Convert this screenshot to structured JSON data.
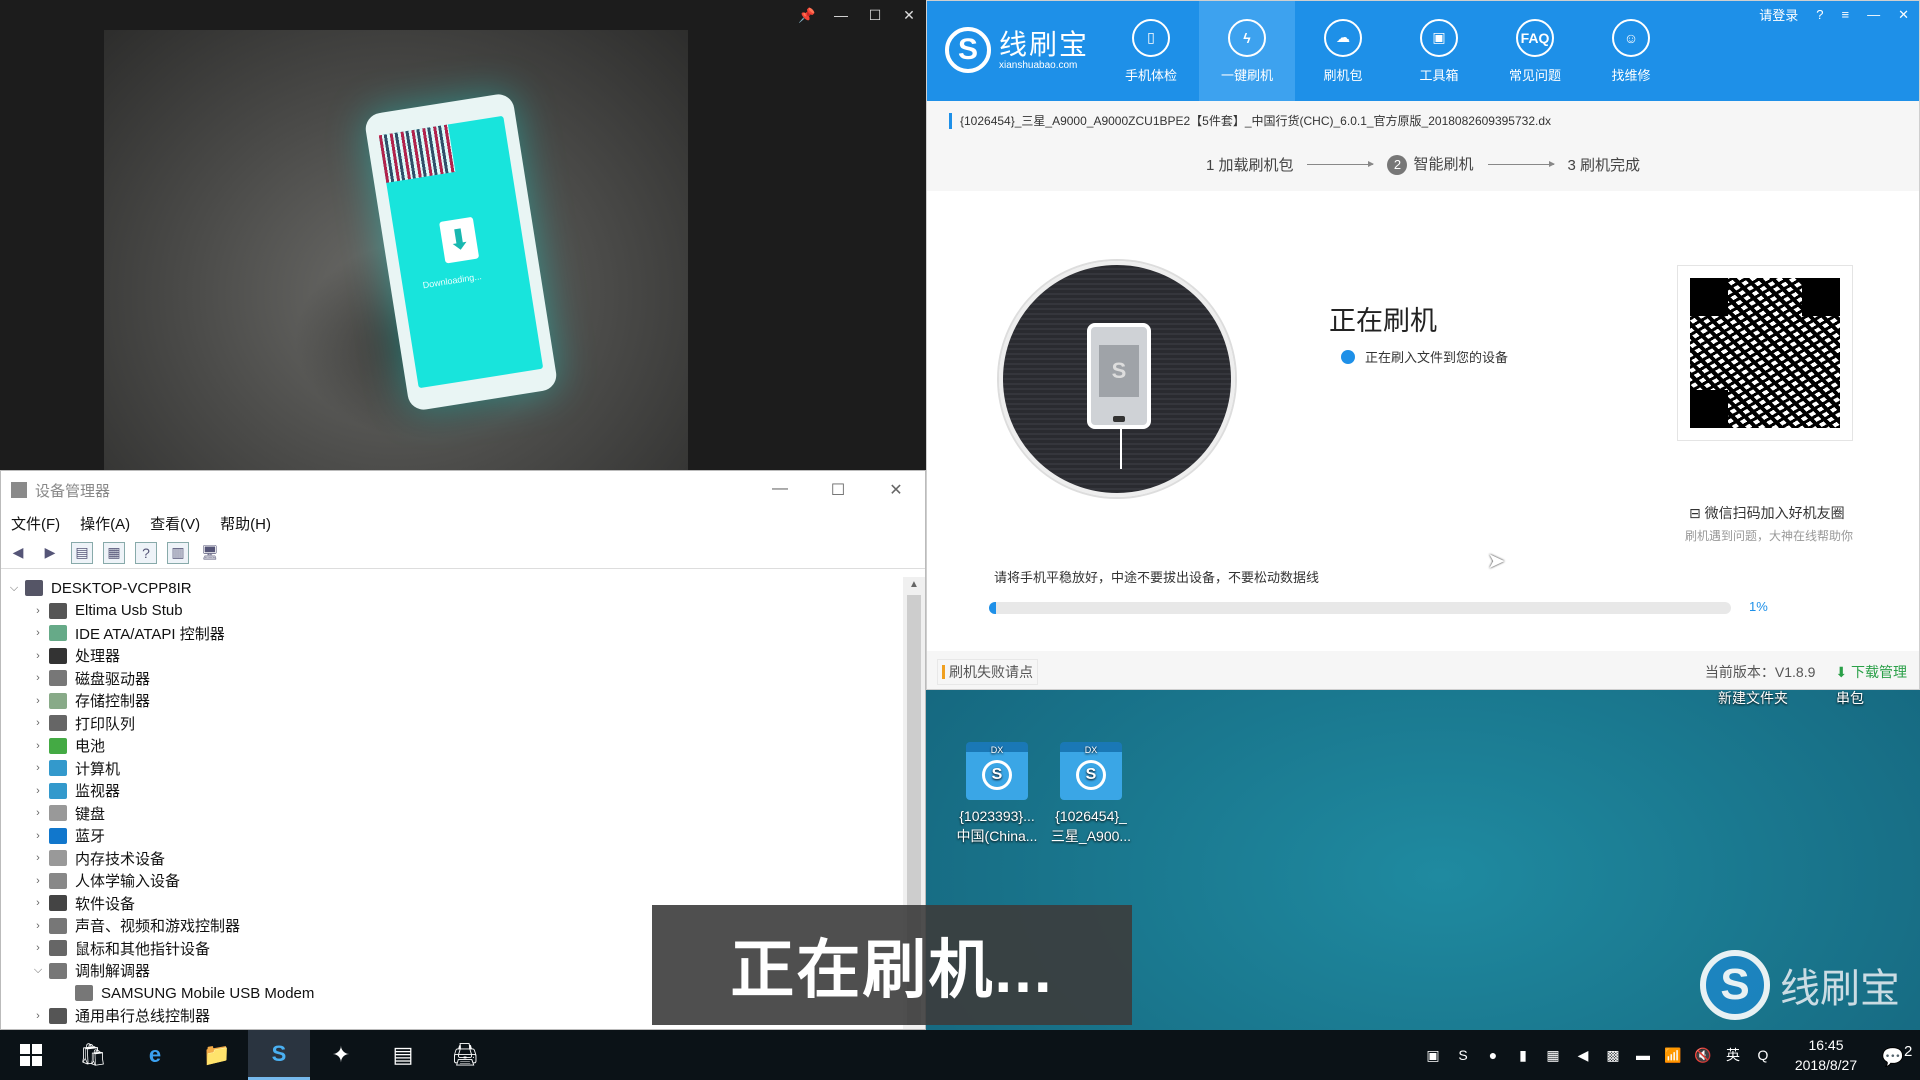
{
  "camera": {
    "controls": [
      "📌",
      "—",
      "☐",
      "✕"
    ],
    "phone_text": "Downloading..."
  },
  "device_manager": {
    "title": "设备管理器",
    "controls": [
      "—",
      "☐",
      "✕"
    ],
    "menu": [
      "文件(F)",
      "操作(A)",
      "查看(V)",
      "帮助(H)"
    ],
    "root": "DESKTOP-VCPP8IR",
    "items": [
      {
        "label": "Eltima Usb Stub",
        "color": "#555",
        "expanded": false
      },
      {
        "label": "IDE ATA/ATAPI 控制器",
        "color": "#6a8",
        "expanded": false
      },
      {
        "label": "处理器",
        "color": "#333",
        "expanded": false
      },
      {
        "label": "磁盘驱动器",
        "color": "#777",
        "expanded": false
      },
      {
        "label": "存储控制器",
        "color": "#8a8",
        "expanded": false
      },
      {
        "label": "打印队列",
        "color": "#666",
        "expanded": false
      },
      {
        "label": "电池",
        "color": "#4a4",
        "expanded": false
      },
      {
        "label": "计算机",
        "color": "#39c",
        "expanded": false
      },
      {
        "label": "监视器",
        "color": "#39c",
        "expanded": false
      },
      {
        "label": "键盘",
        "color": "#999",
        "expanded": false
      },
      {
        "label": "蓝牙",
        "color": "#17c",
        "expanded": false
      },
      {
        "label": "内存技术设备",
        "color": "#999",
        "expanded": false
      },
      {
        "label": "人体学输入设备",
        "color": "#888",
        "expanded": false
      },
      {
        "label": "软件设备",
        "color": "#444",
        "expanded": false
      },
      {
        "label": "声音、视频和游戏控制器",
        "color": "#777",
        "expanded": false
      },
      {
        "label": "鼠标和其他指针设备",
        "color": "#666",
        "expanded": false
      },
      {
        "label": "调制解调器",
        "color": "#777",
        "expanded": true
      },
      {
        "label": "SAMSUNG Mobile USB Modem",
        "color": "#777",
        "child": true
      },
      {
        "label": "通用串行总线控制器",
        "color": "#555",
        "expanded": false
      }
    ]
  },
  "flash_tool": {
    "logo_cn": "线刷宝",
    "logo_en": "xianshuabao.com",
    "logo_glyph": "S",
    "top_right": [
      "请登录",
      "?",
      "≡",
      "—",
      "✕"
    ],
    "nav": [
      {
        "label": "手机体检",
        "icon": "▯",
        "active": false
      },
      {
        "label": "一键刷机",
        "icon": "ϟ",
        "active": true
      },
      {
        "label": "刷机包",
        "icon": "☁",
        "active": false
      },
      {
        "label": "工具箱",
        "icon": "▣",
        "active": false
      },
      {
        "label": "常见问题",
        "icon": "FAQ",
        "active": false
      },
      {
        "label": "找维修",
        "icon": "☺",
        "active": false
      }
    ],
    "file_name": "{1026454}_三星_A9000_A9000ZCU1BPE2【5件套】_中国行货(CHC)_6.0.1_官方原版_2018082609395732.dx",
    "steps": [
      {
        "num": "1",
        "label": "加载刷机包"
      },
      {
        "num": "2",
        "label": "智能刷机"
      },
      {
        "num": "3",
        "label": "刷机完成"
      }
    ],
    "status_title": "正在刷机",
    "status_sub": "正在刷入文件到您的设备",
    "qr_label": "微信扫码加入好机友圈",
    "qr_hint": "刷机遇到问题，大神在线帮助你",
    "warning": "请将手机平稳放好，中途不要拔出设备，不要松动数据线",
    "progress": 0.01,
    "progress_text": "1%",
    "fail_link": "刷机失败请点",
    "version": "当前版本：V1.8.9",
    "download_mgr": "⬇ 下载管理"
  },
  "desktop": {
    "top_labels": [
      "新建文件夹",
      "串包"
    ],
    "icons": [
      {
        "line1": "{1023393}...",
        "line2": "中国(China..."
      },
      {
        "line1": "{1026454}_",
        "line2": "三星_A900..."
      }
    ],
    "icon_badge": "DX"
  },
  "caption": "正在刷机...",
  "watermark": {
    "glyph": "S",
    "text": "线刷宝"
  },
  "taskbar": {
    "apps": [
      "start",
      "🛍",
      "e",
      "📁",
      "S",
      "✦",
      "▤",
      "🖨"
    ],
    "tray": [
      "▣",
      "S",
      "●",
      "▮",
      "▦",
      "◀",
      "▩",
      "▬",
      "📶",
      "🔇",
      "英",
      "Q"
    ],
    "time": "16:45",
    "date": "2018/8/27",
    "notif": "2"
  },
  "colors": {
    "accent": "#1e90e8",
    "download": "#2aa048"
  }
}
